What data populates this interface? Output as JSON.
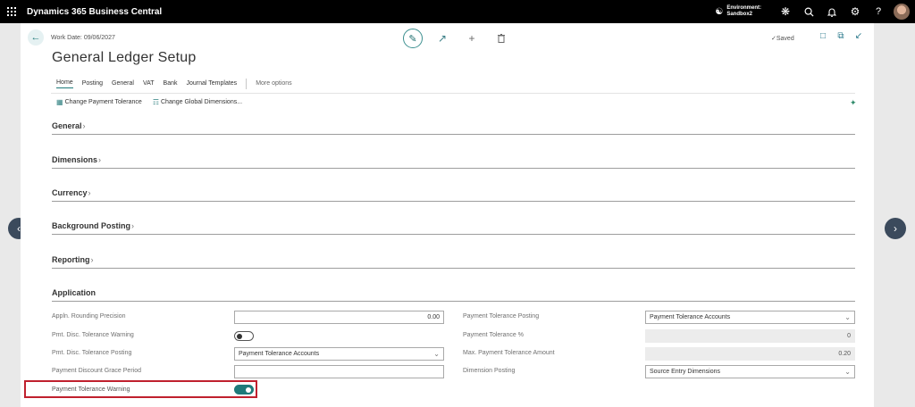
{
  "app": {
    "title": "Dynamics 365 Business Central"
  },
  "environment": {
    "label": "Environment:",
    "name": "Sandbox2"
  },
  "icons": {
    "waffle": "waffle-icon",
    "environment": "building-icon",
    "copilot": "copilot-icon",
    "search": "search-icon",
    "notifications": "bell-icon",
    "settings": "gear-icon",
    "help": "help-icon"
  },
  "header": {
    "work_date": "Work Date: 09/06/2027",
    "saved": "Saved",
    "page_title": "General Ledger Setup"
  },
  "tabs": [
    "Home",
    "Posting",
    "General",
    "VAT",
    "Bank",
    "Journal Templates"
  ],
  "more_options": "More options",
  "actions": {
    "change_payment_tolerance": "Change Payment Tolerance",
    "change_global_dimensions": "Change Global Dimensions..."
  },
  "sections": {
    "general": "General",
    "dimensions": "Dimensions",
    "currency": "Currency",
    "background_posting": "Background Posting",
    "reporting": "Reporting",
    "application": "Application"
  },
  "application": {
    "appln_rounding_precision": {
      "label": "Appln. Rounding Precision",
      "value": "0.00"
    },
    "pmt_disc_tolerance_warning": {
      "label": "Pmt. Disc. Tolerance Warning",
      "on": false
    },
    "pmt_disc_tolerance_posting": {
      "label": "Pmt. Disc. Tolerance Posting",
      "value": "Payment Tolerance Accounts"
    },
    "payment_discount_grace_period": {
      "label": "Payment Discount Grace Period",
      "value": ""
    },
    "payment_tolerance_warning": {
      "label": "Payment Tolerance Warning",
      "on": true
    },
    "payment_tolerance_posting": {
      "label": "Payment Tolerance Posting",
      "value": "Payment Tolerance Accounts"
    },
    "payment_tolerance_pct": {
      "label": "Payment Tolerance %",
      "value": "0"
    },
    "max_payment_tolerance_amount": {
      "label": "Max. Payment Tolerance Amount",
      "value": "0.20"
    },
    "dimension_posting": {
      "label": "Dimension Posting",
      "value": "Source Entry Dimensions"
    }
  },
  "colors": {
    "accent": "#1f7a7a",
    "highlight": "#c0202e",
    "topbar": "#000000"
  }
}
